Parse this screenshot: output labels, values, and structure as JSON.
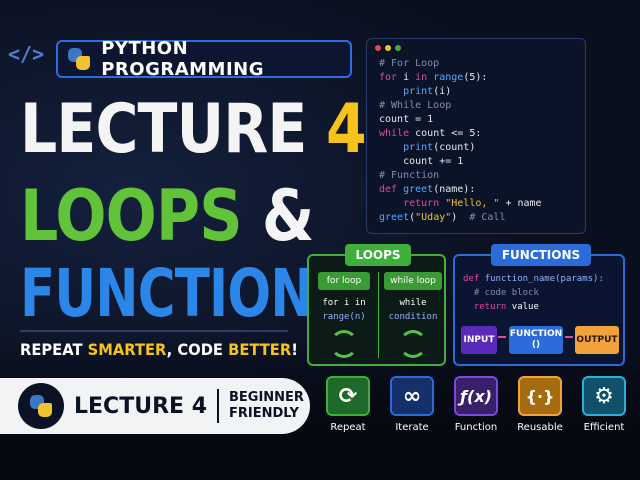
{
  "brand": {
    "label": "PYTHON PROGRAMMING",
    "code_icon": "</>"
  },
  "headline": {
    "line1": "LECTURE",
    "line1_num": "4",
    "line2": "LOOPS",
    "line2_amp": "&",
    "line3": "FUNCTIONS"
  },
  "tagline": {
    "a": "REPEAT ",
    "b": "SMARTER",
    "c": ", CODE ",
    "d": "BETTER",
    "e": "!"
  },
  "pill": {
    "lecture": "LECTURE 4",
    "l1": "BEGINNER",
    "l2": "FRIENDLY"
  },
  "code": {
    "lines": [
      {
        "t": "c",
        "v": "# For Loop"
      },
      {
        "t": "for",
        "v": ""
      },
      {
        "t": "print_i",
        "v": ""
      },
      {
        "t": "c",
        "v": "# While Loop"
      },
      {
        "t": "plain",
        "v": "count = 1"
      },
      {
        "t": "while",
        "v": ""
      },
      {
        "t": "print_count",
        "v": ""
      },
      {
        "t": "plain",
        "v": "    count += 1"
      },
      {
        "t": "c",
        "v": "# Function"
      },
      {
        "t": "def",
        "v": ""
      },
      {
        "t": "ret",
        "v": ""
      },
      {
        "t": "call",
        "v": ""
      }
    ],
    "for_kw": "for",
    "for_rest": " i ",
    "in_kw": "in",
    "range_fn": "range",
    "range_args": "(5):",
    "print_fn": "print",
    "print_i_args": "(i)",
    "while_kw": "while",
    "while_rest": " count <= 5:",
    "print_count_args": "(count)",
    "def_kw": "def",
    "greet_fn": "greet",
    "greet_args": "(name):",
    "return_kw": "return",
    "hello_str": "\"Hello, \"",
    "ret_rest": " + name",
    "call_fn": "greet",
    "call_open": "(",
    "call_str": "\"Uday\"",
    "call_close": ")",
    "call_comment": "  # Call"
  },
  "loops_panel": {
    "title": "LOOPS",
    "for_btn": "for loop",
    "for_l1": "for i in",
    "for_l2": "range(n)",
    "while_btn": "while loop",
    "while_l1": "while",
    "while_l2": "condition"
  },
  "functions_panel": {
    "title": "FUNCTIONS",
    "def_kw": "def",
    "def_rest": " function_name(params):",
    "comment": "  # code block",
    "return_kw": "  return",
    "return_rest": " value",
    "input": "INPUT",
    "function_l1": "FUNCTION",
    "function_l2": "()",
    "output": "OUTPUT"
  },
  "features": [
    {
      "label": "Repeat",
      "icon": "refresh-icon",
      "glyph": "⟳",
      "bg": "#1f6a2a",
      "border": "#3fae3a"
    },
    {
      "label": "Iterate",
      "icon": "infinity-icon",
      "glyph": "∞",
      "bg": "#15306b",
      "border": "#2b6cd8"
    },
    {
      "label": "Function",
      "icon": "function-icon",
      "glyph": "ƒ(x)",
      "bg": "#3a1f6a",
      "border": "#7a4ad8"
    },
    {
      "label": "Reusable",
      "icon": "braces-icon",
      "glyph": "{·}",
      "bg": "#a66a10",
      "border": "#f2a23a"
    },
    {
      "label": "Efficient",
      "icon": "gear-icon",
      "glyph": "⚙",
      "bg": "#10506a",
      "border": "#2bb0d8"
    }
  ]
}
